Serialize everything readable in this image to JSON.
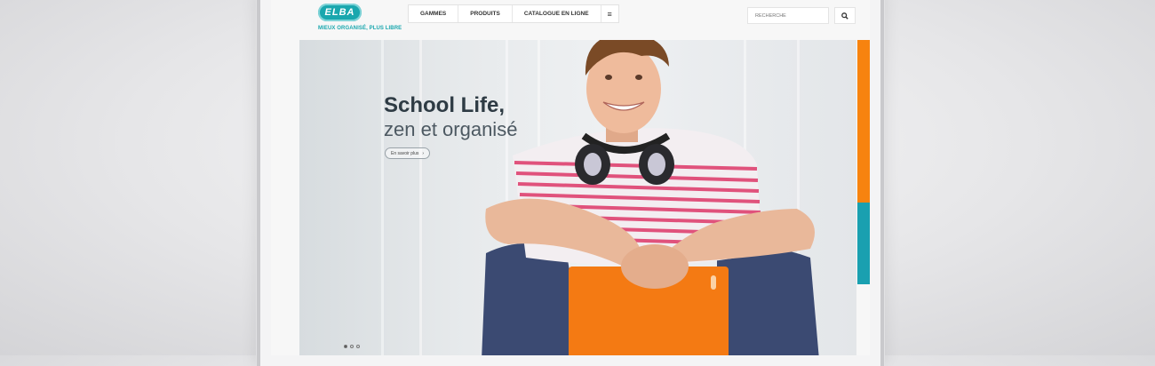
{
  "brand": {
    "logo_text": "ELBA",
    "tagline": "MIEUX ORGANISÉ, PLUS LIBRE",
    "color": "#1aa7ae"
  },
  "nav": {
    "items": [
      "GAMMES",
      "PRODUITS",
      "CATALOGUE EN LIGNE"
    ],
    "menu_icon": "≡"
  },
  "search": {
    "placeholder": "RECHERCHE",
    "icon": "search-icon"
  },
  "hero": {
    "title": "School Life,",
    "subtitle": "zen et organisé",
    "cta_label": "En savoir plus",
    "cta_icon": "›",
    "slides": 3,
    "active_slide": 1
  },
  "colors": {
    "accent_orange": "#f7830f",
    "accent_teal": "#1aa0b0"
  }
}
